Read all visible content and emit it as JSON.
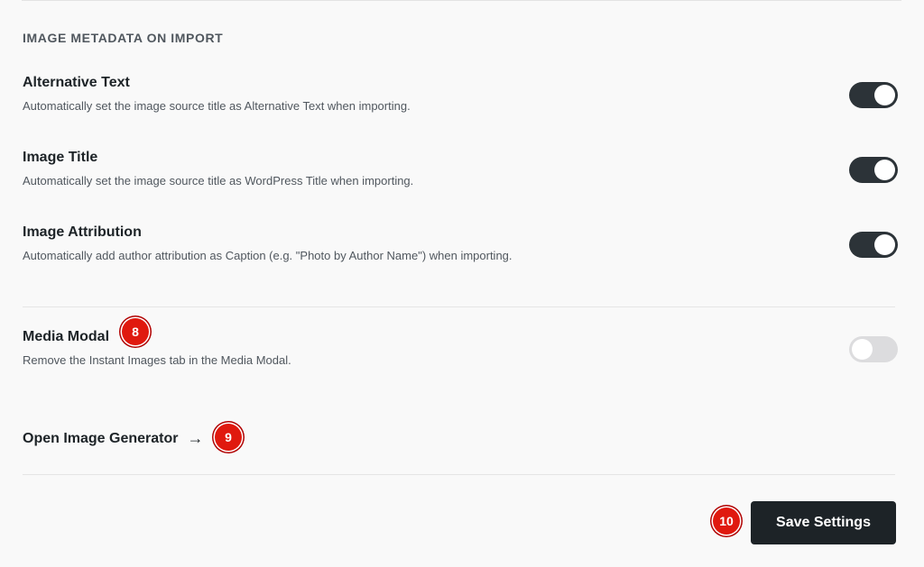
{
  "section": {
    "heading": "IMAGE METADATA ON IMPORT"
  },
  "settings": [
    {
      "title": "Alternative Text",
      "description": "Automatically set the image source title as Alternative Text when importing.",
      "enabled": true
    },
    {
      "title": "Image Title",
      "description": "Automatically set the image source title as WordPress Title when importing.",
      "enabled": true
    },
    {
      "title": "Image Attribution",
      "description": "Automatically add author attribution as Caption (e.g. \"Photo by Author Name\") when importing.",
      "enabled": true
    }
  ],
  "media_modal": {
    "title": "Media Modal",
    "description": "Remove the Instant Images tab in the Media Modal.",
    "enabled": false
  },
  "generator_link": {
    "label": "Open Image Generator",
    "arrow": "→"
  },
  "save_button": {
    "label": "Save Settings"
  },
  "badges": {
    "media_modal": "8",
    "generator": "9",
    "save": "10"
  },
  "colors": {
    "toggle_on": "#2c3338",
    "toggle_off": "#dcdcde",
    "badge": "#e0190f",
    "button": "#1d2327"
  }
}
